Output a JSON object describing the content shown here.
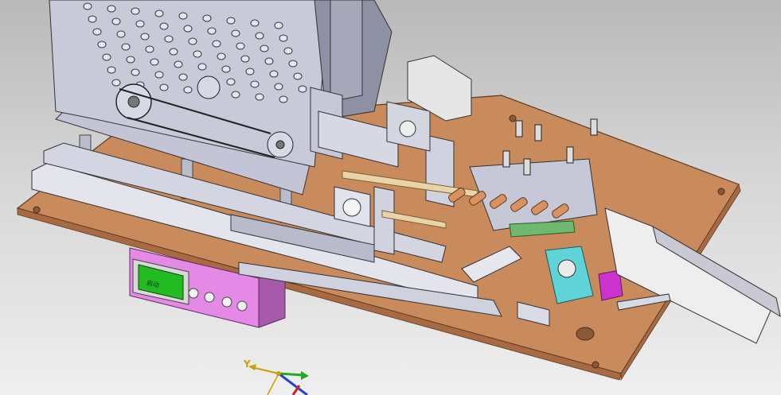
{
  "viewport": {
    "background_top": "#b9b9b9",
    "background_bottom": "#efefef"
  },
  "model": {
    "colors": {
      "base_plate": "#c98a5c",
      "frame_gray": "#c3c5d6",
      "frame_dark": "#8e90a3",
      "control_box": "#e48ae6",
      "hmi_screen": "#22bb22",
      "cyan_part": "#5fd3d8",
      "magenta_part": "#cc33cc",
      "motor_white": "#e6e6e6"
    },
    "hmi_screen_text": "启动",
    "icons": [
      "coordinate-triad-icon"
    ]
  },
  "triad": {
    "y_label": "Y",
    "colors": {
      "y": "#c8a200",
      "x": "#22aa22",
      "z": "#cc2222",
      "n": "#2244cc"
    }
  }
}
